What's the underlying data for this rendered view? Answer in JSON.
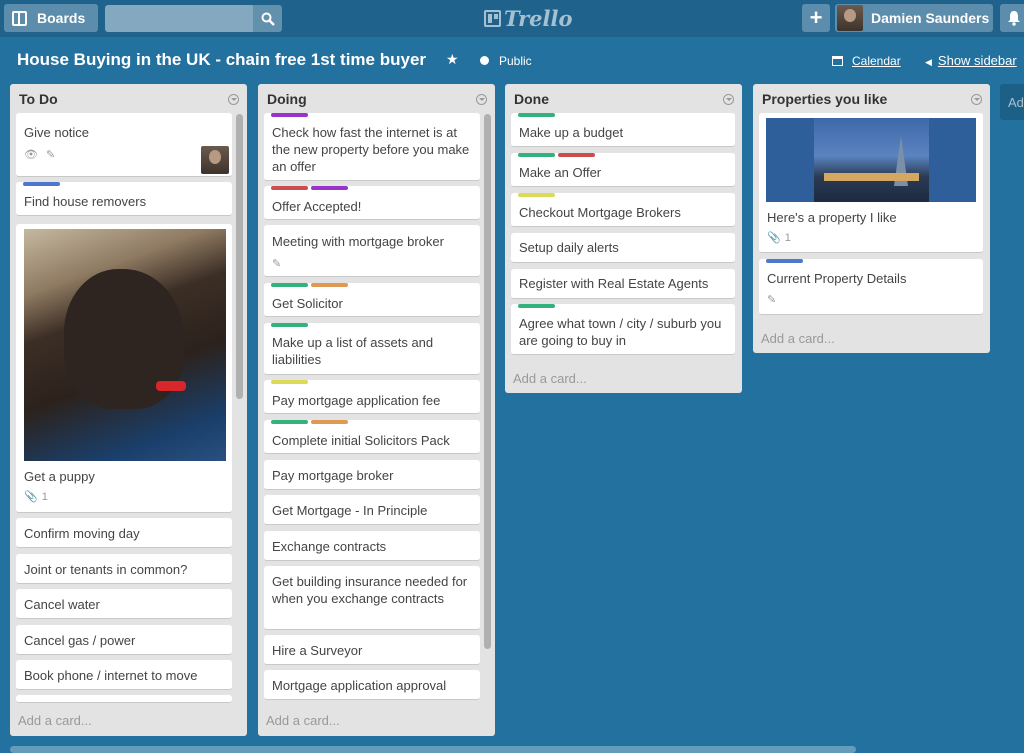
{
  "topbar": {
    "boards_label": "Boards",
    "search_value": "",
    "logo_text": "Trello",
    "user_name": "Damien Saunders"
  },
  "board": {
    "title": "House Buying in the UK - chain free 1st time buyer",
    "visibility": "Public",
    "calendar_label": "Calendar",
    "show_sidebar_label": "Show sidebar",
    "add_list_label": "Add"
  },
  "colors": {
    "green": "#34b27d",
    "red": "#cb4d4d",
    "purple": "#9933cc",
    "blue": "#4d77cb",
    "yellow": "#dbdb57",
    "orange": "#e09952"
  },
  "lists": [
    {
      "title": "To Do",
      "add_card": "Add a card...",
      "cards": [
        {
          "text": "Give notice",
          "labels": []
        },
        {
          "text": "Find house removers",
          "labels": [
            "blue"
          ]
        },
        {
          "text": "Get a puppy",
          "labels": [],
          "attachments": "1"
        },
        {
          "text": "Confirm moving day",
          "labels": []
        },
        {
          "text": "Joint or tenants in common?",
          "labels": []
        },
        {
          "text": "Cancel water",
          "labels": []
        },
        {
          "text": "Cancel gas / power",
          "labels": []
        },
        {
          "text": "Book phone / internet to move",
          "labels": []
        }
      ]
    },
    {
      "title": "Doing",
      "add_card": "Add a card...",
      "cards": [
        {
          "text": "Check how fast the internet is at the new property before you make an offer",
          "labels": [
            "purple"
          ]
        },
        {
          "text": "Offer Accepted!",
          "labels": [
            "red",
            "purple"
          ]
        },
        {
          "text": "Meeting with mortgage broker",
          "labels": []
        },
        {
          "text": "Get Solicitor",
          "labels": [
            "green",
            "orange"
          ]
        },
        {
          "text": "Make up a list of assets and liabilities",
          "labels": [
            "green"
          ]
        },
        {
          "text": "Pay mortgage application fee",
          "labels": [
            "yellow"
          ]
        },
        {
          "text": "Complete initial Solicitors Pack",
          "labels": [
            "green",
            "orange"
          ]
        },
        {
          "text": "Pay mortgage broker",
          "labels": []
        },
        {
          "text": "Get Mortgage - In Principle",
          "labels": []
        },
        {
          "text": "Exchange contracts",
          "labels": []
        },
        {
          "text": "Get building insurance needed for when you exchange contracts",
          "labels": []
        },
        {
          "text": "Hire a Surveyor",
          "labels": []
        },
        {
          "text": "Mortgage application approval",
          "labels": []
        }
      ]
    },
    {
      "title": "Done",
      "add_card": "Add a card...",
      "cards": [
        {
          "text": "Make up a budget",
          "labels": [
            "green"
          ]
        },
        {
          "text": "Make an Offer",
          "labels": [
            "green",
            "red"
          ]
        },
        {
          "text": "Checkout Mortgage Brokers",
          "labels": [
            "yellow"
          ]
        },
        {
          "text": "Setup daily alerts",
          "labels": []
        },
        {
          "text": "Register with Real Estate Agents",
          "labels": []
        },
        {
          "text": "Agree what town / city / suburb you are going to buy in",
          "labels": [
            "green"
          ]
        }
      ]
    },
    {
      "title": "Properties you like",
      "add_card": "Add a card...",
      "cards": [
        {
          "text": "Here's a property I like",
          "labels": [],
          "attachments": "1"
        },
        {
          "text": "Current Property Details",
          "labels": [
            "blue"
          ]
        }
      ]
    }
  ]
}
